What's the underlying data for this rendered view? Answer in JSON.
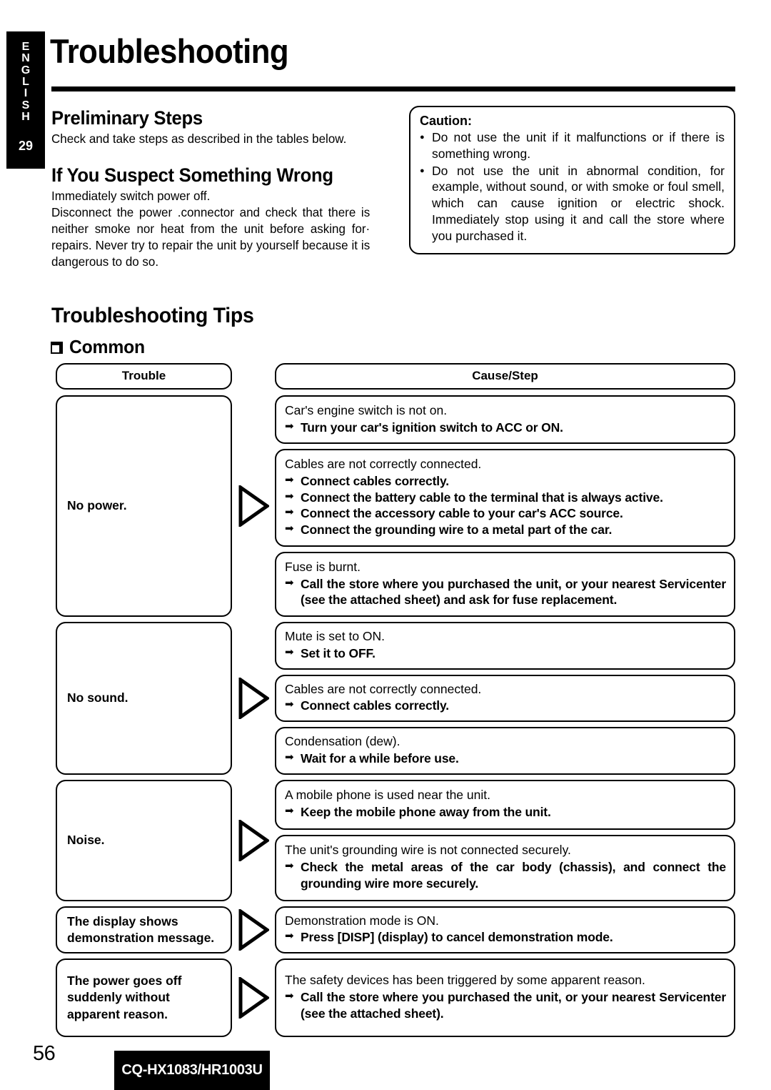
{
  "side_tab": {
    "language_letters": [
      "E",
      "N",
      "G",
      "L",
      "I",
      "S",
      "H"
    ],
    "number": "29"
  },
  "page_title": "Troubleshooting",
  "left_column": {
    "preliminary_heading": "Preliminary Steps",
    "preliminary_body": "Check and take steps as described in the tables below.",
    "suspect_heading": "If You Suspect Something Wrong",
    "suspect_body_1": "Immediately switch power off.",
    "suspect_body_2": "Disconnect the power .connector and check that there is neither smoke nor heat from the unit before asking for· repairs. Never try to repair the unit by yourself because it is dangerous to do so."
  },
  "caution": {
    "title": "Caution:",
    "items": [
      "Do not use the unit if it malfunctions or if there is something wrong.",
      "Do not use the unit in abnormal condition, for example, without sound, or with smoke or foul smell, which can cause ignition or electric shock. Immediately stop using it and call the store where you purchased it."
    ]
  },
  "tips": {
    "heading": "Troubleshooting Tips",
    "section_label": "Common",
    "columns": {
      "trouble": "Trouble",
      "cause_step": "Cause/Step"
    },
    "rows": [
      {
        "trouble": "No power.",
        "causes": [
          {
            "head": "Car's engine switch is not on.",
            "steps": [
              "Turn your car's ignition switch to ACC or ON."
            ]
          },
          {
            "head": "Cables are not correctly connected.",
            "steps": [
              "Connect cables correctly.",
              "Connect the battery cable to the terminal that is always active.",
              "Connect the accessory cable to your car's ACC source.",
              "Connect the grounding wire to a metal part of the car."
            ]
          },
          {
            "head": "Fuse is burnt.",
            "steps": [
              "Call the store where you purchased the unit, or your nearest Servicenter (see the attached sheet) and ask for fuse replacement."
            ],
            "justify": true
          }
        ]
      },
      {
        "trouble": "No sound.",
        "causes": [
          {
            "head": "Mute is set to ON.",
            "steps": [
              "Set it to OFF."
            ]
          },
          {
            "head": "Cables are not correctly connected.",
            "steps": [
              "Connect cables correctly."
            ]
          },
          {
            "head": "Condensation (dew).",
            "steps": [
              "Wait for a while before use."
            ]
          }
        ]
      },
      {
        "trouble": "Noise.",
        "causes": [
          {
            "head": "A mobile phone is used near the unit.",
            "steps": [
              "Keep the mobile phone away from the unit."
            ]
          },
          {
            "head": "The unit's grounding wire is not connected securely.",
            "steps": [
              "Check the metal areas of the car body (chassis), and connect the grounding wire more securely."
            ],
            "justify": true
          }
        ]
      },
      {
        "trouble": "The display shows demonstration message.",
        "causes": [
          {
            "head": "Demonstration mode is ON.",
            "steps": [
              "Press [DISP] (display) to cancel demonstration mode."
            ]
          }
        ]
      },
      {
        "trouble": "The power goes off suddenly without apparent reason.",
        "causes": [
          {
            "head": "The safety devices has been triggered by some apparent reason.",
            "steps": [
              "Call the store where you purchased the unit, or your nearest Servicenter (see the attached sheet)."
            ],
            "justify": true
          }
        ]
      }
    ]
  },
  "footer": {
    "page_number": "56",
    "model": "CQ-HX1083/HR1003U"
  }
}
